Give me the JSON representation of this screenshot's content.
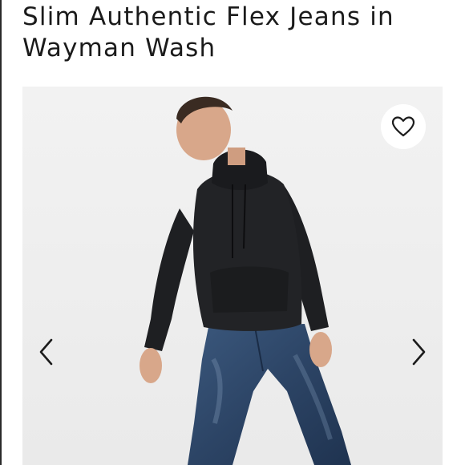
{
  "product": {
    "title": "Slim Authentic Flex Jeans in Wayman Wash"
  },
  "gallery": {
    "image_description": "product-photo",
    "favorite_icon": "heart-outline-icon",
    "prev_icon": "chevron-left-icon",
    "next_icon": "chevron-right-icon"
  },
  "colors": {
    "background": "#ffffff",
    "photo_background": "#efefef",
    "hoodie": "#1e1f22",
    "denim": "#2f4a6e",
    "skin": "#d8a78a",
    "text": "#1b1b1b"
  }
}
